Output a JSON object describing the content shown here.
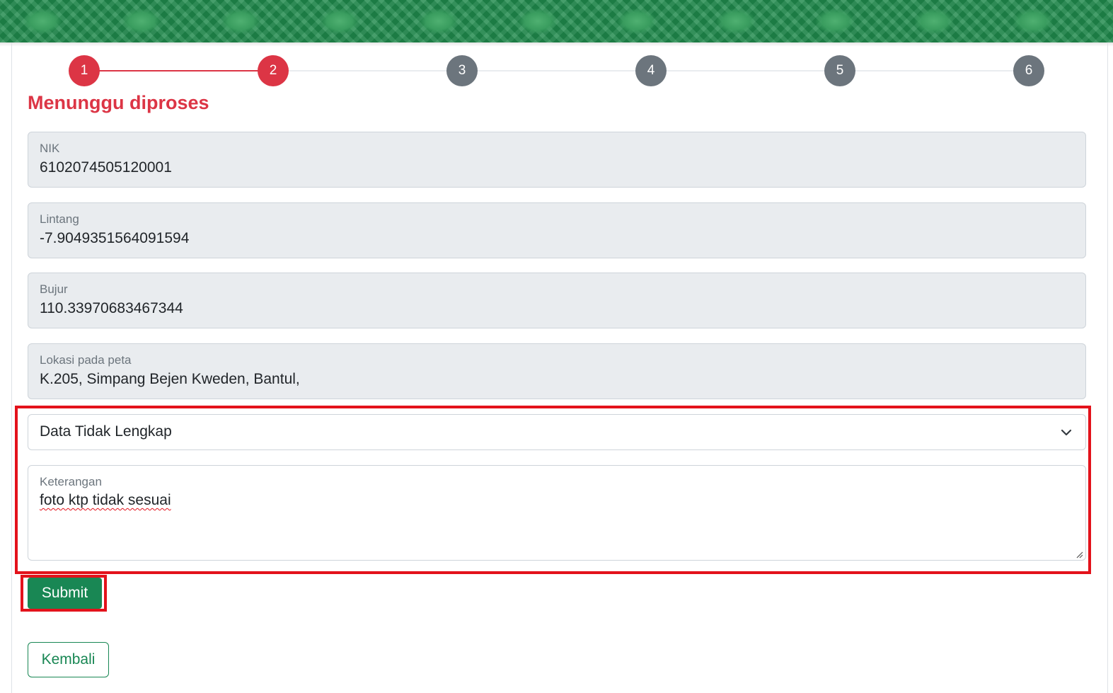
{
  "stepper": {
    "steps": [
      {
        "label": "1",
        "state": "active"
      },
      {
        "label": "2",
        "state": "active"
      },
      {
        "label": "3",
        "state": "inactive"
      },
      {
        "label": "4",
        "state": "inactive"
      },
      {
        "label": "5",
        "state": "inactive"
      },
      {
        "label": "6",
        "state": "inactive"
      }
    ]
  },
  "page": {
    "title": "Menunggu diproses"
  },
  "fields": {
    "nik": {
      "label": "NIK",
      "value": "6102074505120001"
    },
    "lintang": {
      "label": "Lintang",
      "value": "-7.9049351564091594"
    },
    "bujur": {
      "label": "Bujur",
      "value": "110.33970683467344"
    },
    "lokasi": {
      "label": "Lokasi pada peta",
      "value": "K.205, Simpang Bejen Kweden, Bantul,"
    }
  },
  "status_select": {
    "selected": "Data Tidak Lengkap",
    "icon": "chevron-down-icon"
  },
  "keterangan": {
    "label": "Keterangan",
    "value": "foto ktp tidak sesuai"
  },
  "actions": {
    "submit_label": "Submit",
    "back_label": "Kembali"
  },
  "colors": {
    "accent_red": "#dc3545",
    "step_inactive": "#6c757d",
    "success_green": "#198754",
    "highlight_red": "#e3121b"
  }
}
